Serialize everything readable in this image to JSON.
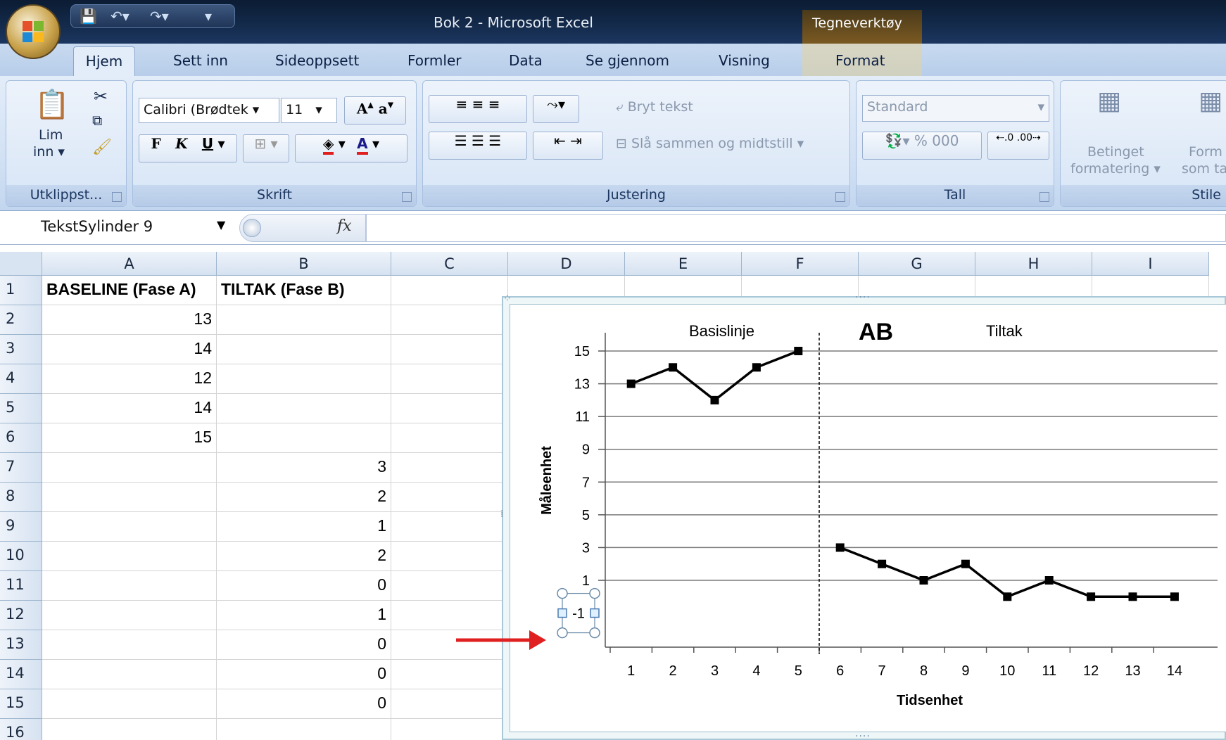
{
  "titlebar": {
    "title": "Bok 2 - Microsoft Excel",
    "contextual_tab": "Tegneverktøy"
  },
  "tabs": [
    "Hjem",
    "Sett inn",
    "Sideoppsett",
    "Formler",
    "Data",
    "Se gjennom",
    "Visning",
    "Format"
  ],
  "ribbon": {
    "clipboard": {
      "paste_label_1": "Lim",
      "paste_label_2": "inn ▾",
      "group": "Utklippst..."
    },
    "font": {
      "name": "Calibri (Brødtek",
      "size": "11",
      "bold": "F",
      "italic": "K",
      "underline": "U",
      "group": "Skrift"
    },
    "alignment": {
      "wrap": "Bryt tekst",
      "merge": "Slå sammen og midtstill",
      "group": "Justering"
    },
    "number": {
      "format": "Standard",
      "percent": "%",
      "thousands": "000",
      "group": "Tall"
    },
    "styles": {
      "conditional_1": "Betinget",
      "conditional_2": "formatering ▾",
      "table_1": "Form",
      "table_2": "som ta",
      "group": "Stile"
    }
  },
  "formula_bar": {
    "name_box": "TekstSylinder 9",
    "fx": "fx",
    "value": ""
  },
  "columns": [
    "A",
    "B",
    "C",
    "D",
    "E",
    "F",
    "G",
    "H",
    "I"
  ],
  "rows": [
    {
      "n": "1",
      "a": "BASELINE (Fase A)",
      "b": "TILTAK (Fase B)"
    },
    {
      "n": "2",
      "a": "13",
      "b": ""
    },
    {
      "n": "3",
      "a": "14",
      "b": ""
    },
    {
      "n": "4",
      "a": "12",
      "b": ""
    },
    {
      "n": "5",
      "a": "14",
      "b": ""
    },
    {
      "n": "6",
      "a": "15",
      "b": ""
    },
    {
      "n": "7",
      "a": "",
      "b": "3"
    },
    {
      "n": "8",
      "a": "",
      "b": "2"
    },
    {
      "n": "9",
      "a": "",
      "b": "1"
    },
    {
      "n": "10",
      "a": "",
      "b": "2"
    },
    {
      "n": "11",
      "a": "",
      "b": "0"
    },
    {
      "n": "12",
      "a": "",
      "b": "1"
    },
    {
      "n": "13",
      "a": "",
      "b": "0"
    },
    {
      "n": "14",
      "a": "",
      "b": "0"
    },
    {
      "n": "15",
      "a": "",
      "b": "0"
    },
    {
      "n": "16",
      "a": "",
      "b": ""
    }
  ],
  "chart_data": {
    "type": "line",
    "title": "",
    "xlabel": "Tidsenhet",
    "ylabel": "Måleenhet",
    "x": [
      1,
      2,
      3,
      4,
      5,
      6,
      7,
      8,
      9,
      10,
      11,
      12,
      13,
      14
    ],
    "series": [
      {
        "name": "BASELINE (Fase A)",
        "x": [
          1,
          2,
          3,
          4,
          5
        ],
        "values": [
          13,
          14,
          12,
          14,
          15
        ]
      },
      {
        "name": "TILTAK (Fase B)",
        "x": [
          6,
          7,
          8,
          9,
          10,
          11,
          12,
          13,
          14
        ],
        "values": [
          3,
          2,
          1,
          2,
          0,
          1,
          0,
          0,
          0
        ]
      }
    ],
    "yticks": [
      1,
      3,
      5,
      7,
      9,
      11,
      13,
      15
    ],
    "selected_tick_label": "-1",
    "ylim": [
      -1,
      16
    ],
    "grid": true,
    "phase_divider_after_x": 5,
    "annotations": {
      "baseline_label": "Basislinje",
      "phase_heading": "AB",
      "treatment_label": "Tiltak"
    },
    "colors": {
      "line": "#000000",
      "arrow": "#e02020"
    }
  }
}
